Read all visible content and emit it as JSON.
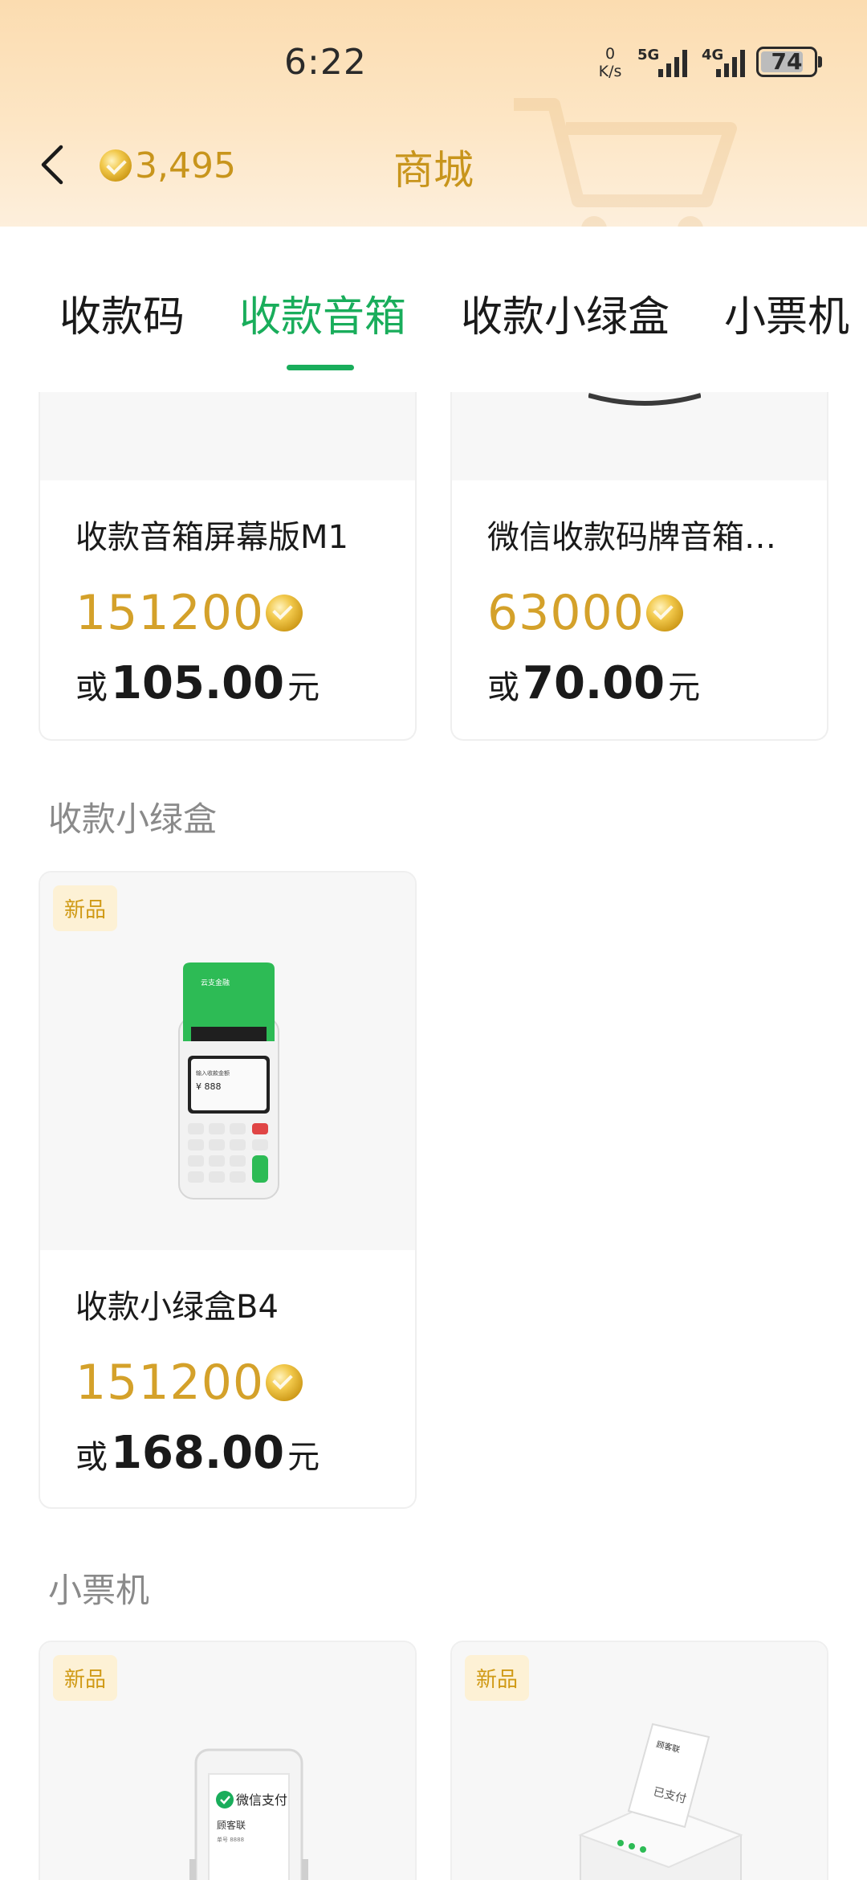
{
  "status_bar": {
    "time": "6:22",
    "net_speed_value": "0",
    "net_speed_unit": "K/s",
    "sig1_label": "5G",
    "sig2_label": "4G",
    "battery": "74"
  },
  "header": {
    "coins": "3,495",
    "title": "商城"
  },
  "tabs": [
    {
      "label": "收款码",
      "active": false
    },
    {
      "label": "收款音箱",
      "active": true
    },
    {
      "label": "收款小绿盒",
      "active": false
    },
    {
      "label": "小票机",
      "active": false
    }
  ],
  "top_products": [
    {
      "name": "收款音箱屏幕版M1",
      "coin_price": "151200",
      "or": "或",
      "cash_price": "105.00",
      "unit": "元"
    },
    {
      "name": "微信收款码牌音箱…",
      "coin_price": "63000",
      "or": "或",
      "cash_price": "70.00",
      "unit": "元"
    }
  ],
  "section_green_box": {
    "title": "收款小绿盒",
    "product": {
      "badge": "新品",
      "name": "收款小绿盒B4",
      "coin_price": "151200",
      "or": "或",
      "cash_price": "168.00",
      "unit": "元",
      "device_brand": "云支金融",
      "device_screen_line1": "输入收款金额",
      "device_screen_amount": "¥ 888"
    }
  },
  "section_printer": {
    "title": "小票机",
    "products": [
      {
        "badge": "新品",
        "device_logo_text": "微信支付",
        "device_receipt_title": "顾客联",
        "device_receipt_line": "单号 8888"
      },
      {
        "badge": "新品",
        "device_receipt_text": "顾客联",
        "device_receipt_stamp": "已支付"
      }
    ]
  },
  "colors": {
    "accent_green": "#19ad5b",
    "gold": "#c8951c",
    "price_gold": "#d4a12a"
  }
}
